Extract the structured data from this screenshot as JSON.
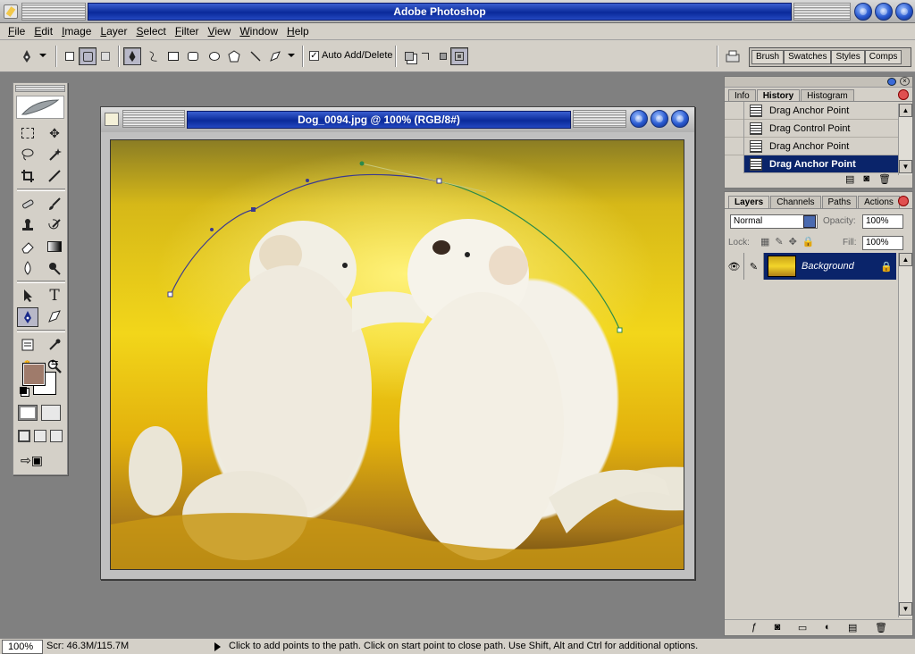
{
  "app": {
    "title": "Adobe Photoshop"
  },
  "menu": [
    "File",
    "Edit",
    "Image",
    "Layer",
    "Select",
    "Filter",
    "View",
    "Window",
    "Help"
  ],
  "options": {
    "auto_add_delete_label": "Auto Add/Delete",
    "auto_add_delete_checked": "✓",
    "palette_well_tabs": [
      "Brush",
      "Swatches",
      "Styles",
      "Comps"
    ]
  },
  "toolbox": {
    "foreground_color": "#9f7b6b",
    "background_color": "#ffffff",
    "active_tool": "pen-tool"
  },
  "document": {
    "title": "Dog_0094.jpg @ 100% (RGB/8#)"
  },
  "history_panel": {
    "tabs": [
      "Info",
      "History",
      "Histogram"
    ],
    "active_tab": "History",
    "items": [
      {
        "label": "Drag Anchor Point",
        "selected": false
      },
      {
        "label": "Drag Control Point",
        "selected": false
      },
      {
        "label": "Drag Anchor Point",
        "selected": false
      },
      {
        "label": "Drag Anchor Point",
        "selected": true
      }
    ]
  },
  "layers_panel": {
    "tabs": [
      "Layers",
      "Channels",
      "Paths",
      "Actions"
    ],
    "active_tab": "Layers",
    "blend_mode": "Normal",
    "opacity_label": "Opacity:",
    "opacity_value": "100%",
    "lock_label": "Lock:",
    "fill_label": "Fill:",
    "fill_value": "100%",
    "layers": [
      {
        "name": "Background",
        "locked": true,
        "visible": true
      }
    ]
  },
  "status": {
    "zoom": "100%",
    "scratch": "Scr: 46.3M/115.7M",
    "hint": "Click to add points to the path.  Click on start point to close path.  Use Shift, Alt and Ctrl for additional options."
  }
}
